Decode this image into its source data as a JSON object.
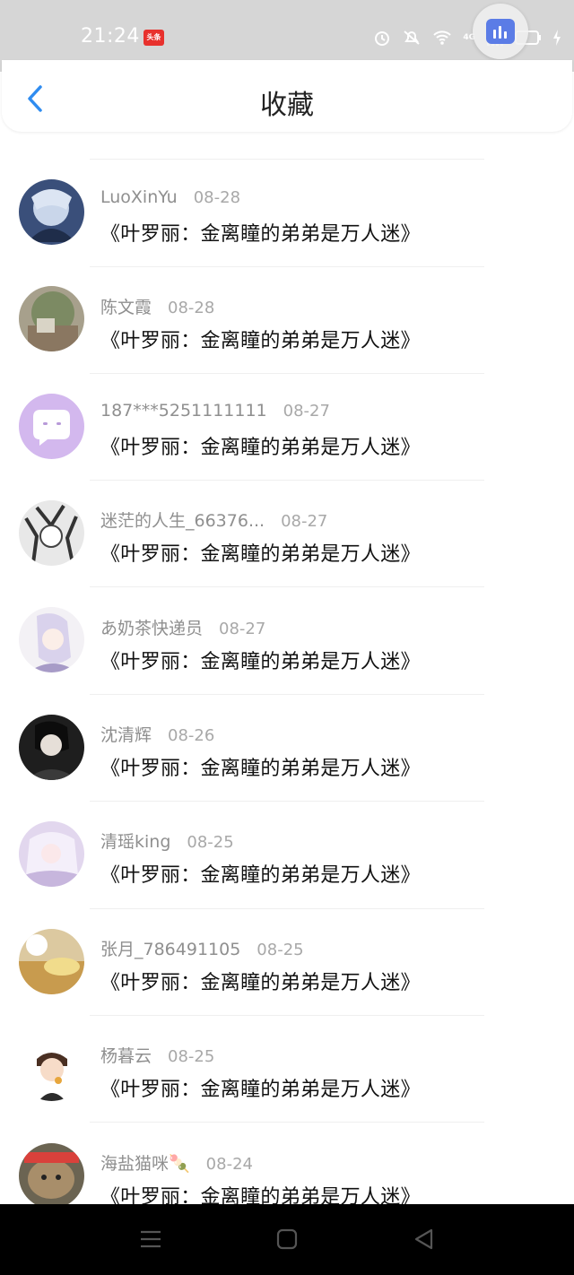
{
  "status_bar": {
    "time": "21:24",
    "notification_badge": "头条",
    "network": "4G",
    "icons": [
      "alarm-icon",
      "mute-icon",
      "wifi-icon",
      "signal-icon",
      "battery-icon",
      "charging-icon"
    ]
  },
  "header": {
    "title": "收藏",
    "back_icon": "chevron-left-icon"
  },
  "favorites": [
    {
      "user": "LuoXinYu",
      "date": "08-28",
      "book": "《叶罗丽：金离瞳的弟弟是万人迷》",
      "avatar": "anime-character"
    },
    {
      "user": "陈文霞",
      "date": "08-28",
      "book": "《叶罗丽：金离瞳的弟弟是万人迷》",
      "avatar": "landscape-photo"
    },
    {
      "user": "187***5251111111",
      "date": "08-27",
      "book": "《叶罗丽：金离瞳的弟弟是万人迷》",
      "avatar": "default-chat-avatar"
    },
    {
      "user": "迷茫的人生_66376...",
      "date": "08-27",
      "book": "《叶罗丽：金离瞳的弟弟是万人迷》",
      "avatar": "manga-character"
    },
    {
      "user": "あ奶茶快递员",
      "date": "08-27",
      "book": "《叶罗丽：金离瞳的弟弟是万人迷》",
      "avatar": "anime-character"
    },
    {
      "user": "沈清辉",
      "date": "08-26",
      "book": "《叶罗丽：金离瞳的弟弟是万人迷》",
      "avatar": "anime-character"
    },
    {
      "user": "清瑶king",
      "date": "08-25",
      "book": "《叶罗丽：金离瞳的弟弟是万人迷》",
      "avatar": "anime-character"
    },
    {
      "user": "张月_786491105",
      "date": "08-25",
      "book": "《叶罗丽：金离瞳的弟弟是万人迷》",
      "avatar": "tea-photo"
    },
    {
      "user": "杨暮云",
      "date": "08-25",
      "book": "《叶罗丽：金离瞳的弟弟是万人迷》",
      "avatar": "cartoon-boy"
    },
    {
      "user": "海盐猫咪🍡",
      "date": "08-24",
      "book": "《叶罗丽：金离瞳的弟弟是万人迷》",
      "avatar": "hamster-photo"
    }
  ],
  "colors": {
    "accent": "#2f8cf0",
    "status_bar": "#d6d6d6",
    "username": "#8f8f8f",
    "title": "#222222"
  },
  "nav_buttons": [
    "menu-icon",
    "home-icon",
    "back-triangle-icon"
  ]
}
